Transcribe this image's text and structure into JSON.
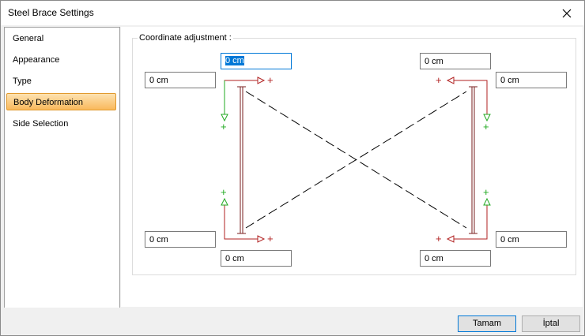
{
  "window": {
    "title": "Steel Brace Settings",
    "close_icon": "close-icon"
  },
  "sidebar": {
    "items": [
      {
        "label": "General"
      },
      {
        "label": "Appearance"
      },
      {
        "label": "Type"
      },
      {
        "label": "Body Deformation",
        "selected": true
      },
      {
        "label": "Side Selection"
      }
    ]
  },
  "group": {
    "label": "Coordinate adjustment :"
  },
  "fields": {
    "top_left_x": {
      "value": "0 cm",
      "selected": true
    },
    "top_left_y": {
      "value": "0 cm"
    },
    "top_right_x": {
      "value": "0 cm"
    },
    "top_right_y": {
      "value": "0 cm"
    },
    "bottom_left_y": {
      "value": "0 cm"
    },
    "bottom_left_x": {
      "value": "0 cm"
    },
    "bottom_right_y": {
      "value": "0 cm"
    },
    "bottom_right_x": {
      "value": "0 cm"
    }
  },
  "diagram": {
    "plus_glyph": "+",
    "colors": {
      "horizontal_arrow": "#b22222",
      "vertical_arrow": "#22aa22",
      "column": "#7a1f1f",
      "brace": "#000000"
    }
  },
  "buttons": {
    "ok": "Tamam",
    "cancel": "İptal"
  }
}
